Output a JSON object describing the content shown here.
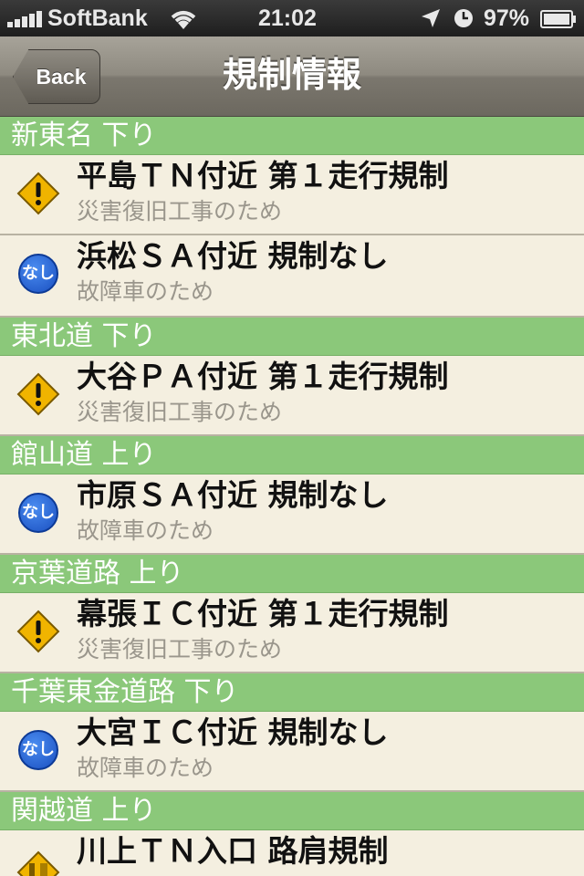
{
  "status_bar": {
    "carrier": "SoftBank",
    "time": "21:02",
    "battery": "97%",
    "icons": [
      "signal-icon",
      "wifi-icon",
      "location-icon",
      "clock-icon",
      "battery-icon"
    ]
  },
  "nav": {
    "back_label": "Back",
    "title": "規制情報"
  },
  "sections": [
    {
      "header": "新東名 下り",
      "items": [
        {
          "title": "平島ＴＮ付近 第１走行規制",
          "subtitle": "災害復旧工事のため",
          "icon": "warning-icon"
        },
        {
          "title": "浜松ＳＡ付近 規制なし",
          "subtitle": "故障車のため",
          "icon": "no-restriction-icon"
        }
      ]
    },
    {
      "header": "東北道 下り",
      "items": [
        {
          "title": "大谷ＰＡ付近 第１走行規制",
          "subtitle": "災害復旧工事のため",
          "icon": "warning-icon"
        }
      ]
    },
    {
      "header": "館山道 上り",
      "items": [
        {
          "title": "市原ＳＡ付近 規制なし",
          "subtitle": "故障車のため",
          "icon": "no-restriction-icon"
        }
      ]
    },
    {
      "header": "京葉道路 上り",
      "items": [
        {
          "title": "幕張ＩＣ付近 第１走行規制",
          "subtitle": "災害復旧工事のため",
          "icon": "warning-icon"
        }
      ]
    },
    {
      "header": "千葉東金道路 下り",
      "items": [
        {
          "title": "大宮ＩＣ付近 規制なし",
          "subtitle": "故障車のため",
          "icon": "no-restriction-icon"
        }
      ]
    },
    {
      "header": "関越道 上り",
      "items": [
        {
          "title": "川上ＴＮ入口 路肩規制",
          "subtitle": "",
          "icon": "shoulder-restriction-icon"
        }
      ]
    }
  ],
  "icon_text": {
    "nashi": "なし"
  },
  "colors": {
    "section_header": "#8bc87a",
    "row_background": "#f4efe0",
    "warning_yellow": "#f0b400",
    "nashi_blue": "#1a4fc0"
  }
}
